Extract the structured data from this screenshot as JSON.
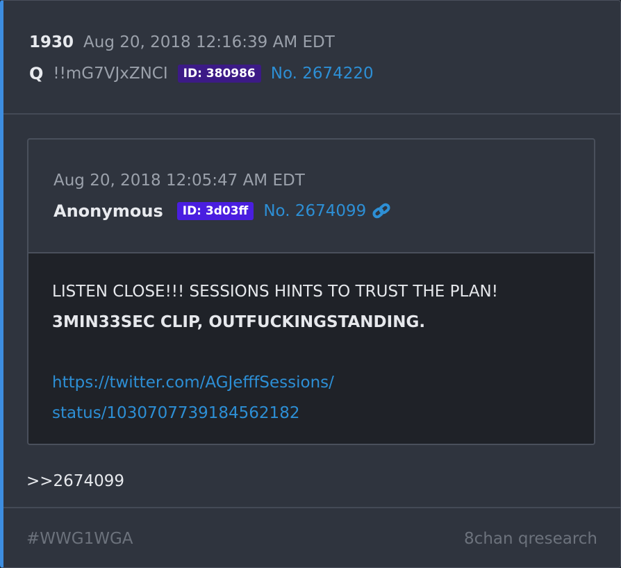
{
  "post": {
    "number": "1930",
    "timestamp": "Aug 20, 2018 12:16:39 AM EDT",
    "author": "Q",
    "tripcode": "!!mG7VJxZNCI",
    "id_badge": "ID: 380986",
    "post_no": "No. 2674220",
    "reply_ref": ">>2674099"
  },
  "quoted": {
    "timestamp": "Aug 20, 2018 12:05:47 AM EDT",
    "author": "Anonymous",
    "id_badge": "ID: 3d03ff",
    "post_no": "No. 2674099",
    "line1": "LISTEN CLOSE!!! SESSIONS HINTS TO TRUST THE PLAN!",
    "line2": "3MIN33SEC CLIP, OUTFUCKINGSTANDING.",
    "link_line1": "https://twitter.com/AGJefffSessions/",
    "link_line2": "status/1030707739184562182"
  },
  "footer": {
    "hashtag": "#WWG1WGA",
    "source": "8chan qresearch"
  },
  "colors": {
    "q_id_badge": "#3c1a86",
    "anon_id_badge": "#4a1ee0",
    "link": "#2d8fd5",
    "accent_border": "#3d8de0"
  },
  "icons": {
    "permalink": "link-icon"
  }
}
